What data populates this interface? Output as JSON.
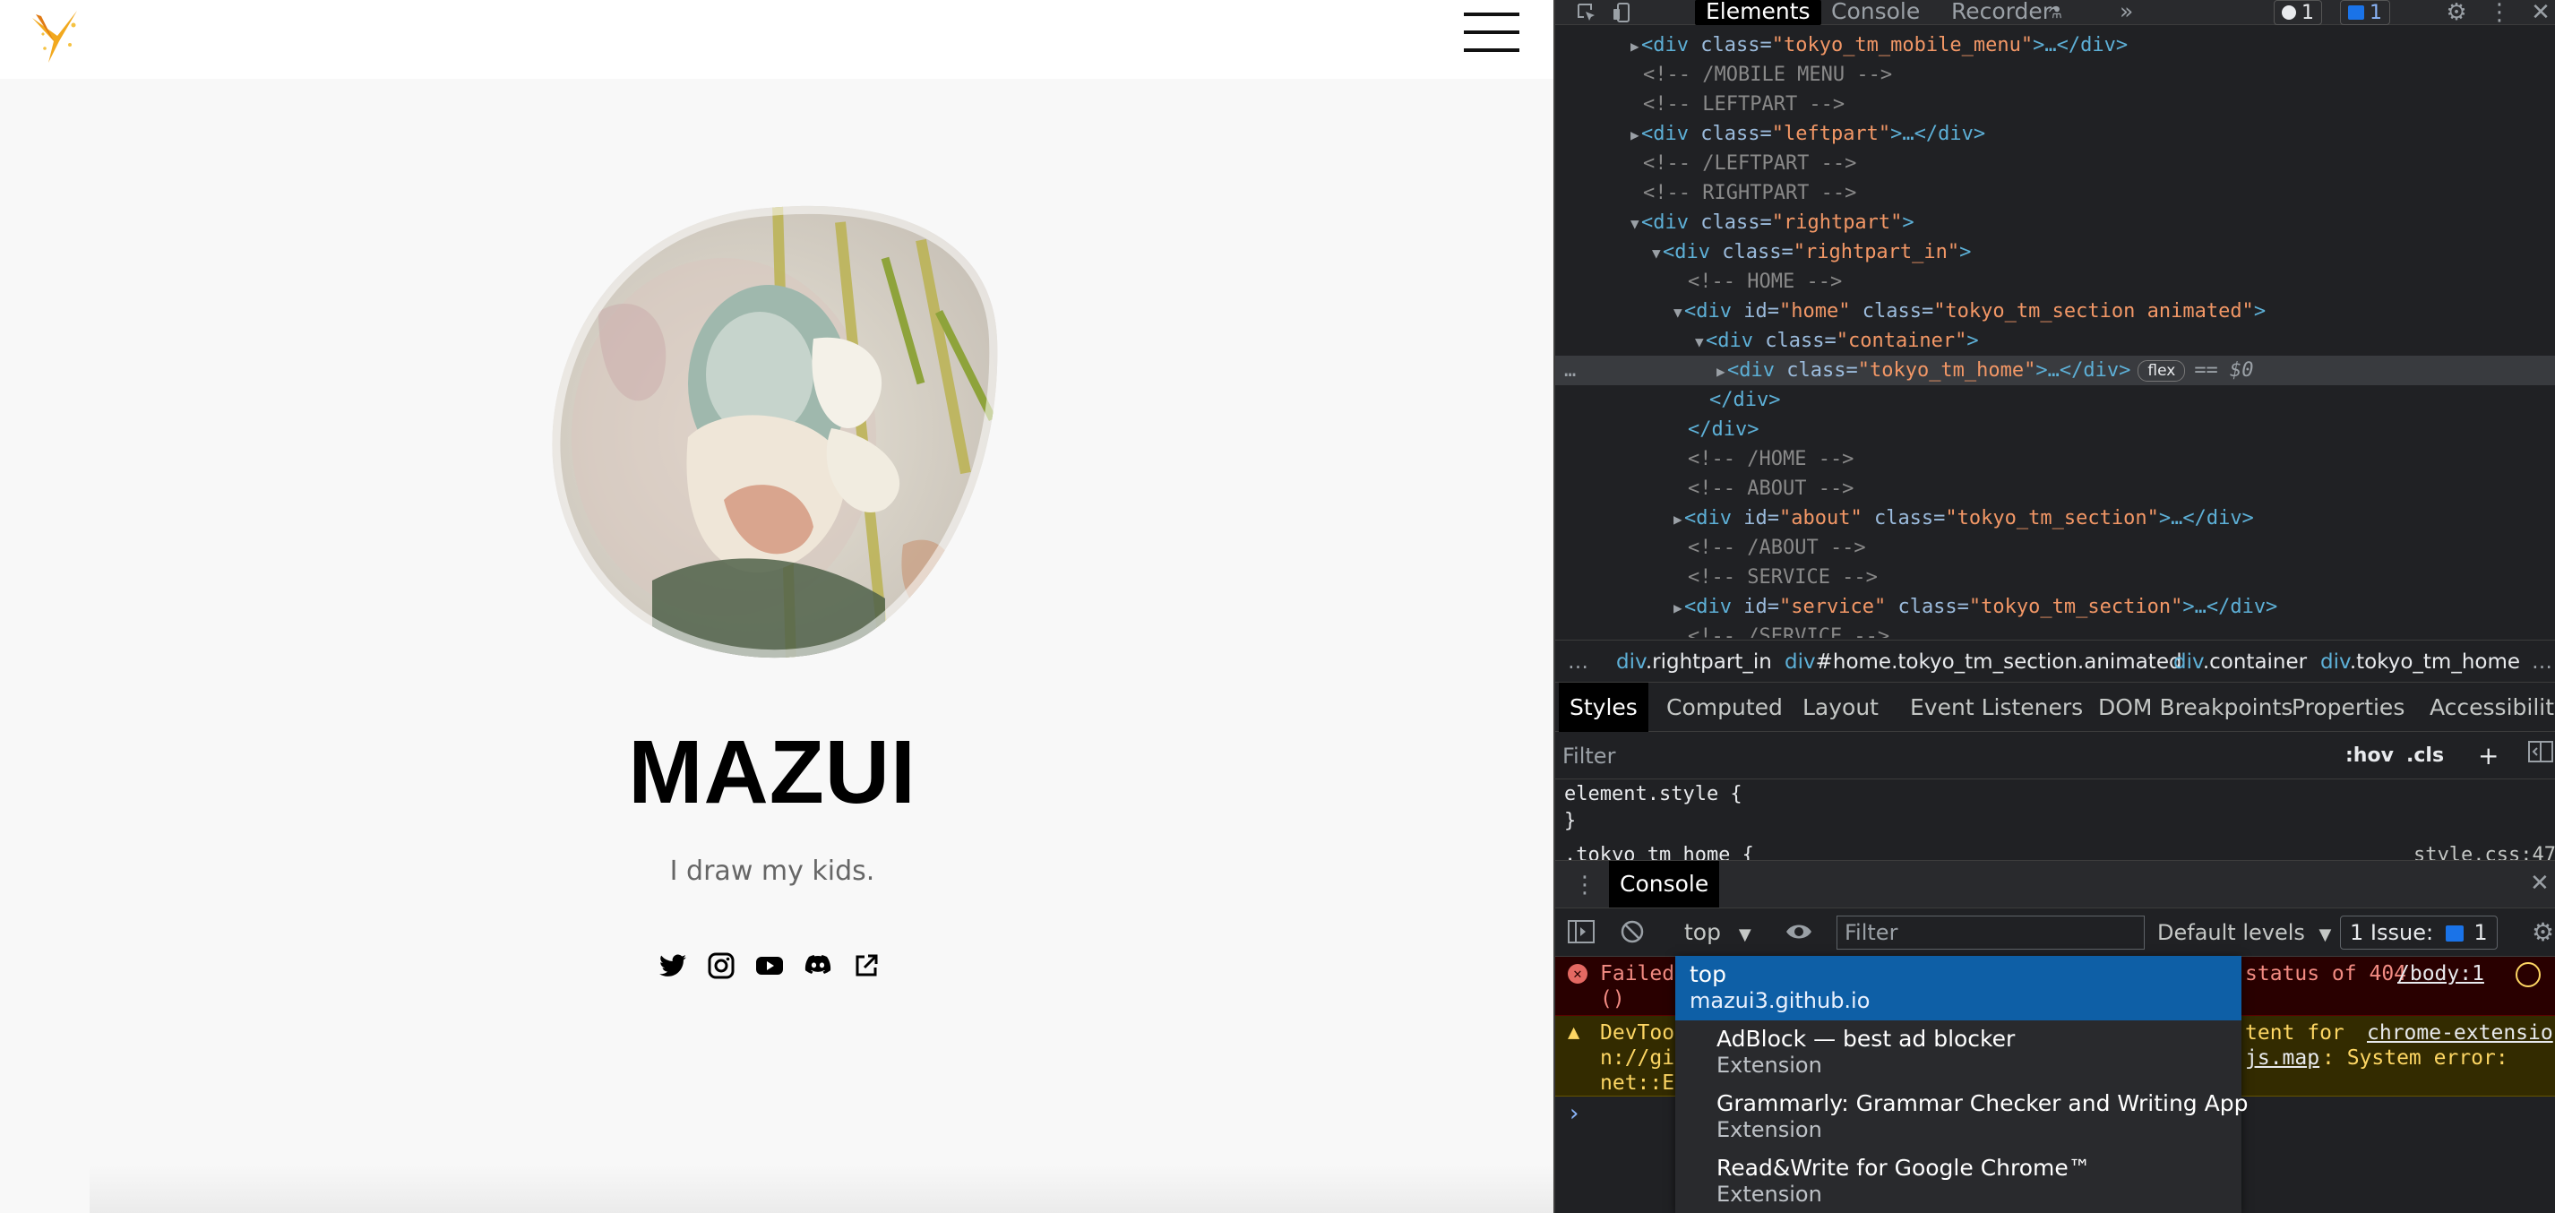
{
  "site": {
    "title": "MAZUI",
    "subtitle": "I draw my kids.",
    "social_icons": [
      "twitter-icon",
      "instagram-icon",
      "youtube-icon",
      "discord-icon",
      "external-link-icon"
    ]
  },
  "devtools": {
    "panel_tabs": [
      "Elements",
      "Console",
      "Recorder",
      "»"
    ],
    "badges": {
      "errors": "1",
      "messages": "1"
    },
    "dom": {
      "l1": {
        "tag_open": "<div ",
        "attr": "class=",
        "val": "\"tokyo_tm_mobile_menu\"",
        "rest": ">…</div>"
      },
      "l2": "<!-- /MOBILE MENU -->",
      "l3": "<!-- LEFTPART -->",
      "l4": {
        "tag_open": "<div ",
        "attr": "class=",
        "val": "\"leftpart\"",
        "rest": ">…</div>"
      },
      "l5": "<!-- /LEFTPART -->",
      "l6": "<!-- RIGHTPART -->",
      "l7": {
        "tag_open": "<div ",
        "attr": "class=",
        "val": "\"rightpart\"",
        "rest": ">"
      },
      "l8": {
        "tag_open": "<div ",
        "attr": "class=",
        "val": "\"rightpart_in\"",
        "rest": ">"
      },
      "l9": "<!-- HOME -->",
      "l10": {
        "tag_open": "<div ",
        "attr1": "id=",
        "val1": "\"home\"",
        "attr2": " class=",
        "val2": "\"tokyo_tm_section animated\"",
        "rest": ">"
      },
      "l11": {
        "tag_open": "<div ",
        "attr": "class=",
        "val": "\"container\"",
        "rest": ">"
      },
      "l12": {
        "tag_open": "<div ",
        "attr": "class=",
        "val": "\"tokyo_tm_home\"",
        "rest": ">…</div>",
        "badge": "flex",
        "eq": "== $0"
      },
      "l13": "</div>",
      "l14": "</div>",
      "l15": "<!-- /HOME -->",
      "l16": "<!-- ABOUT -->",
      "l17": {
        "tag_open": "<div ",
        "attr1": "id=",
        "val1": "\"about\"",
        "attr2": " class=",
        "val2": "\"tokyo_tm_section\"",
        "rest": ">…</div>"
      },
      "l18": "<!-- /ABOUT -->",
      "l19": "<!-- SERVICE -->",
      "l20": {
        "tag_open": "<div ",
        "attr1": "id=",
        "val1": "\"service\"",
        "attr2": " class=",
        "val2": "\"tokyo_tm_section\"",
        "rest": ">…</div>"
      },
      "l21": "<!-- /SERVICE -->"
    },
    "breadcrumbs": [
      {
        "tag": "div",
        "cls": ".rightpart_in"
      },
      {
        "tag": "div",
        "cls": "#home.tokyo_tm_section.animated"
      },
      {
        "tag": "div",
        "cls": ".container"
      },
      {
        "tag": "div",
        "cls": ".tokyo_tm_home"
      }
    ],
    "styles_tabs": [
      "Styles",
      "Computed",
      "Layout",
      "Event Listeners",
      "DOM Breakpoints",
      "Properties",
      "Accessibility"
    ],
    "styles_filter_placeholder": "Filter",
    "hov": ":hov",
    "cls": ".cls",
    "plus": "+",
    "element_style_open": "element.style {",
    "element_style_close": "}",
    "rule_selector": ".tokyo_tm_home {",
    "rule_source": "style.css:47",
    "drawer_tab": "Console",
    "console": {
      "context": "top",
      "filter_placeholder": "Filter",
      "levels": "Default levels",
      "issues_label": "1 Issue:",
      "issues_count": "1",
      "error_start": "Failed",
      "error_paren": "()",
      "error_end": "status of 404",
      "error_link": "/body:1",
      "warn_l1_start": "DevToo",
      "warn_l1_mid": "tent for ",
      "warn_l1_link": "chrome-extensio",
      "warn_l2_start": "n://gi",
      "warn_l2_link": "js.map",
      "warn_l2_end": ": System error:",
      "warn_l3": "net::ER",
      "prompt": "›"
    },
    "context_menu": [
      {
        "line1": "top",
        "line2": "mazui3.github.io",
        "selected": true
      },
      {
        "line1": "AdBlock — best ad blocker",
        "line2": "Extension"
      },
      {
        "line1": "Grammarly: Grammar Checker and Writing App",
        "line2": "Extension"
      },
      {
        "line1": "Read&Write for Google Chrome™",
        "line2": "Extension"
      }
    ]
  },
  "colors": {
    "dt_bg": "#202124",
    "tag": "#5db0d7",
    "attr_value": "#f29766",
    "selected_menu": "#0e5fa6"
  }
}
